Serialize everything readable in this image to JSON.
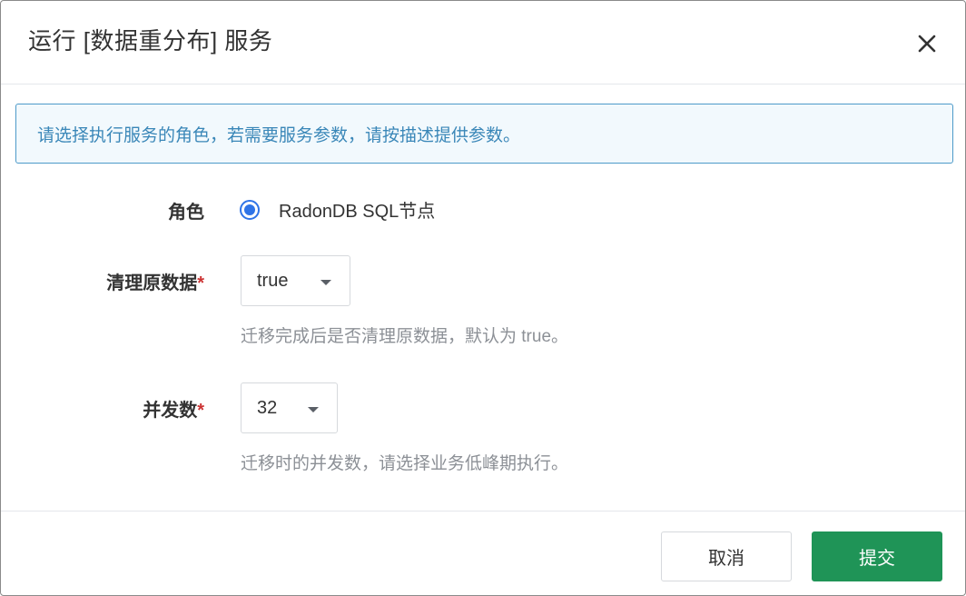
{
  "dialog": {
    "title": "运行 [数据重分布] 服务",
    "close_icon": "close-icon"
  },
  "banner": {
    "text": "请选择执行服务的角色，若需要服务参数，请按描述提供参数。",
    "text_color": "#3a87b8",
    "border_color": "#4d9ac9"
  },
  "form": {
    "role": {
      "label": "角色",
      "option_label": "RadonDB SQL节点",
      "selected": true
    },
    "clean_data": {
      "label": "清理原数据",
      "required_mark": "*",
      "value": "true",
      "help": "迁移完成后是否清理原数据，默认为 true。"
    },
    "concurrency": {
      "label": "并发数",
      "required_mark": "*",
      "value": "32",
      "help": "迁移时的并发数，请选择业务低峰期执行。"
    }
  },
  "footer": {
    "cancel_label": "取消",
    "submit_label": "提交",
    "submit_color": "#1f9457"
  }
}
